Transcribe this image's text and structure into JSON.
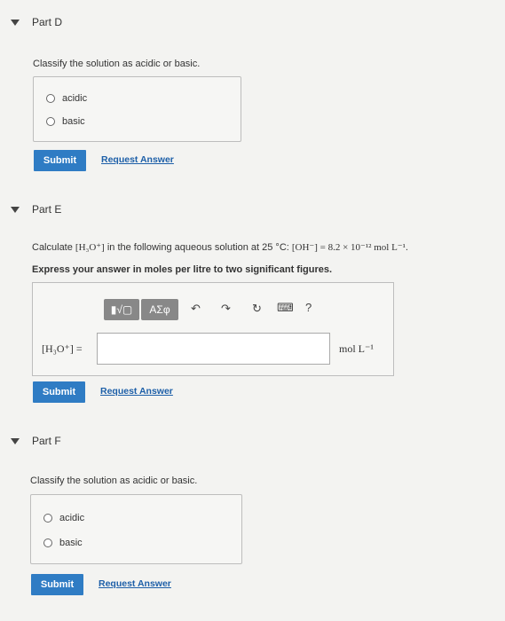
{
  "partD": {
    "title": "Part D",
    "prompt": "Classify the solution as acidic or basic.",
    "options": [
      "acidic",
      "basic"
    ],
    "submit": "Submit",
    "request": "Request Answer"
  },
  "partE": {
    "title": "Part E",
    "prompt_pre": "Calculate ",
    "prompt_species": "[H₃O⁺]",
    "prompt_mid": " in the following aqueous solution at 25 °C: ",
    "prompt_expr": "[OH⁻] = 8.2 × 10⁻¹² mol L⁻¹",
    "prompt_end": ".",
    "instruction": "Express your answer in moles per litre to two significant figures.",
    "toolbar": {
      "template_btn": "▮√▢",
      "greek_btn": "ΑΣφ",
      "undo": "↶",
      "redo": "↷",
      "reset": "↻",
      "keyboard": "⌨",
      "help": "?"
    },
    "input_label": "[H₃O⁺] =",
    "input_value": "",
    "unit": "mol L⁻¹",
    "submit": "Submit",
    "request": "Request Answer"
  },
  "partF": {
    "title": "Part F",
    "prompt": "Classify the solution as acidic or basic.",
    "options": [
      "acidic",
      "basic"
    ],
    "submit": "Submit",
    "request": "Request Answer"
  }
}
